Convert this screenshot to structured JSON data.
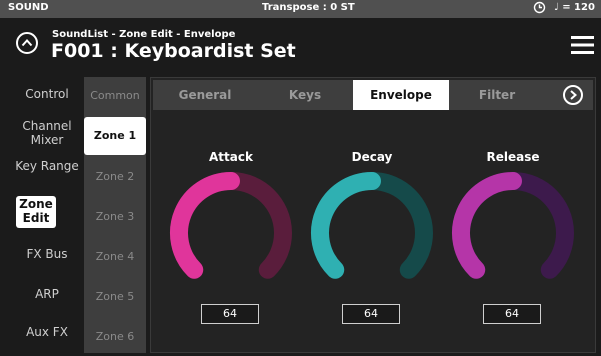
{
  "status_bar": {
    "left_label": "SOUND",
    "center_label": "Transpose : 0 ST",
    "tempo_label": "♩ = 120"
  },
  "header": {
    "breadcrumb": "SoundList - Zone Edit - Envelope",
    "title": "F001 : Keyboardist Set"
  },
  "left_nav": {
    "items": [
      {
        "label": "Control",
        "active": false
      },
      {
        "label": "Channel Mixer",
        "active": false
      },
      {
        "label": "Key Range",
        "active": false
      },
      {
        "label": "Zone Edit",
        "active": true
      },
      {
        "label": "FX Bus",
        "active": false
      },
      {
        "label": "ARP",
        "active": false
      },
      {
        "label": "Aux FX",
        "active": false
      }
    ]
  },
  "zone_list": {
    "items": [
      {
        "label": "Common",
        "active": false
      },
      {
        "label": "Zone 1",
        "active": true
      },
      {
        "label": "Zone 2",
        "active": false
      },
      {
        "label": "Zone 3",
        "active": false
      },
      {
        "label": "Zone 4",
        "active": false
      },
      {
        "label": "Zone 5",
        "active": false
      },
      {
        "label": "Zone 6",
        "active": false
      }
    ]
  },
  "tabs": [
    {
      "label": "General",
      "active": false
    },
    {
      "label": "Keys",
      "active": false
    },
    {
      "label": "Envelope",
      "active": true
    },
    {
      "label": "Filter",
      "active": false
    }
  ],
  "knobs": [
    {
      "label": "Attack",
      "value": "64",
      "fraction": 0.5,
      "color": "#e0359b",
      "track_color": "#5a1d3c"
    },
    {
      "label": "Decay",
      "value": "64",
      "fraction": 0.5,
      "color": "#2fb0b2",
      "track_color": "#154a4a"
    },
    {
      "label": "Release",
      "value": "64",
      "fraction": 0.5,
      "color": "#b535a8",
      "track_color": "#3d1a4c"
    }
  ],
  "icons": {
    "back": "circle-chevron-up-icon",
    "menu": "hamburger-menu-icon",
    "next_tab": "circle-chevron-right-icon",
    "clock": "clock-icon"
  }
}
